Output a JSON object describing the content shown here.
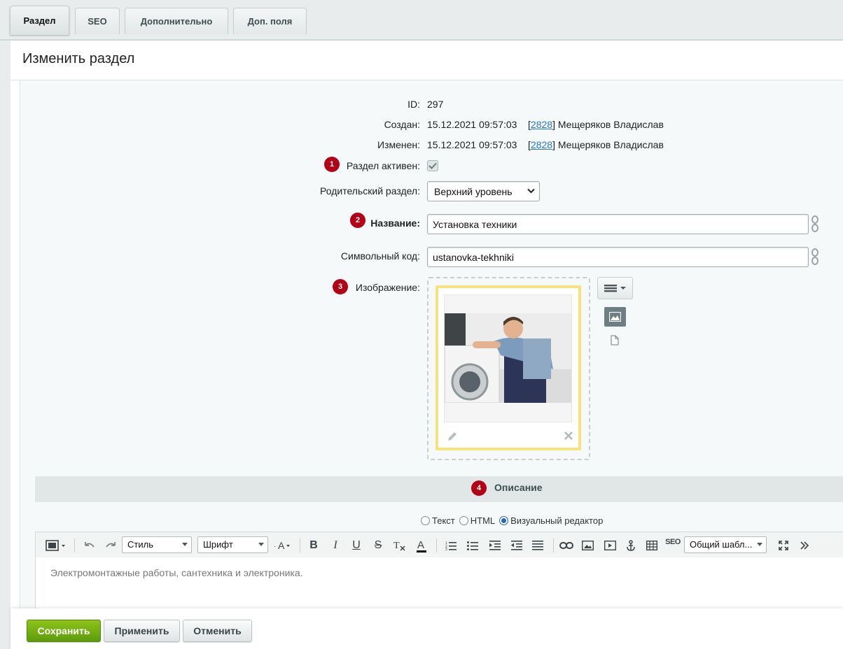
{
  "tabs": [
    {
      "label": "Раздел"
    },
    {
      "label": "SEO"
    },
    {
      "label": "Дополнительно"
    },
    {
      "label": "Доп. поля"
    }
  ],
  "page_title": "Изменить раздел",
  "form": {
    "id": {
      "label": "ID:",
      "value": "297"
    },
    "created": {
      "label": "Создан:",
      "date": "15.12.2021 09:57:03",
      "user_id": "2828",
      "user_name": "Мещеряков Владислав"
    },
    "modified": {
      "label": "Изменен:",
      "date": "15.12.2021 09:57:03",
      "user_id": "2828",
      "user_name": "Мещеряков Владислав"
    },
    "active": {
      "label": "Раздел активен:",
      "checked": true,
      "badge": "1"
    },
    "parent": {
      "label": "Родительский раздел:",
      "value": "Верхний уровень"
    },
    "name": {
      "label": "Название:",
      "value": "Установка техники",
      "badge": "2"
    },
    "code": {
      "label": "Символьный код:",
      "value": "ustanovka-tekhniki"
    },
    "image": {
      "label": "Изображение:",
      "badge": "3"
    }
  },
  "description": {
    "title": "Описание",
    "badge": "4",
    "modes": [
      {
        "label": "Текст",
        "selected": false
      },
      {
        "label": "HTML",
        "selected": false
      },
      {
        "label": "Визуальный редактор",
        "selected": true
      }
    ],
    "toolbar": {
      "style": "Стиль",
      "font": "Шрифт",
      "template": "Общий шабл...",
      "seo": "SEO"
    },
    "content": "Электромонтажные работы, сантехника и электроника."
  },
  "buttons": {
    "save": "Сохранить",
    "apply": "Применить",
    "cancel": "Отменить"
  },
  "colors": {
    "accent_red": "#b30016",
    "save_green": "#6aa90f",
    "link_blue": "#2675d7"
  }
}
